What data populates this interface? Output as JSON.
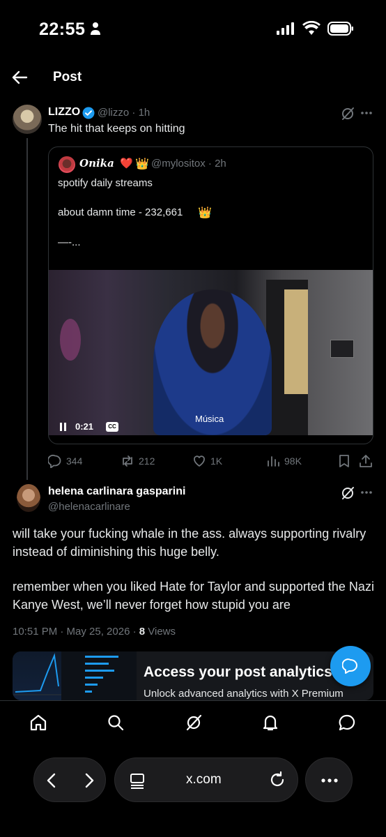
{
  "status_bar": {
    "time": "22:55"
  },
  "header": {
    "title": "Post"
  },
  "post": {
    "author_name": "LIZZO",
    "author_handle": "@lizzo · 1h",
    "text": "The hit that keeps on hitting",
    "quote": {
      "author_name": "𝑶𝒏𝒊𝒌𝒂",
      "heart": "❤️",
      "crown": "👑",
      "handle": "@mylositox · 2h",
      "line1": "spotify daily streams",
      "line2": "about damn time - 232,661",
      "line3": "—-...",
      "video": {
        "elapsed": "0:21",
        "cc_label": "CC",
        "caption": "Música"
      }
    },
    "actions": {
      "replies": "344",
      "reposts": "212",
      "likes": "1K",
      "views": "98K"
    }
  },
  "reply": {
    "author_name": "helena carlinara gasparini",
    "author_handle": "@helenacarlinare",
    "paragraph1": "will take your fucking whale in the ass. always supporting rivalry instead of diminishing this huge belly.",
    "paragraph2": "remember when you liked Hate for Taylor and supported the Nazi Kanye West, we’ll never forget how stupid you are",
    "timestamp": "10:51 PM · May 25, 2026 · ",
    "views_count": "8",
    "views_label": " Views"
  },
  "analytics_card": {
    "title": "Access your post analytics",
    "subtitle": "Unlock advanced analytics with X Premium"
  },
  "browser": {
    "url": "x.com"
  },
  "colors": {
    "accent": "#1d9bf0",
    "secondary_text": "#71767b",
    "background": "#000000"
  }
}
